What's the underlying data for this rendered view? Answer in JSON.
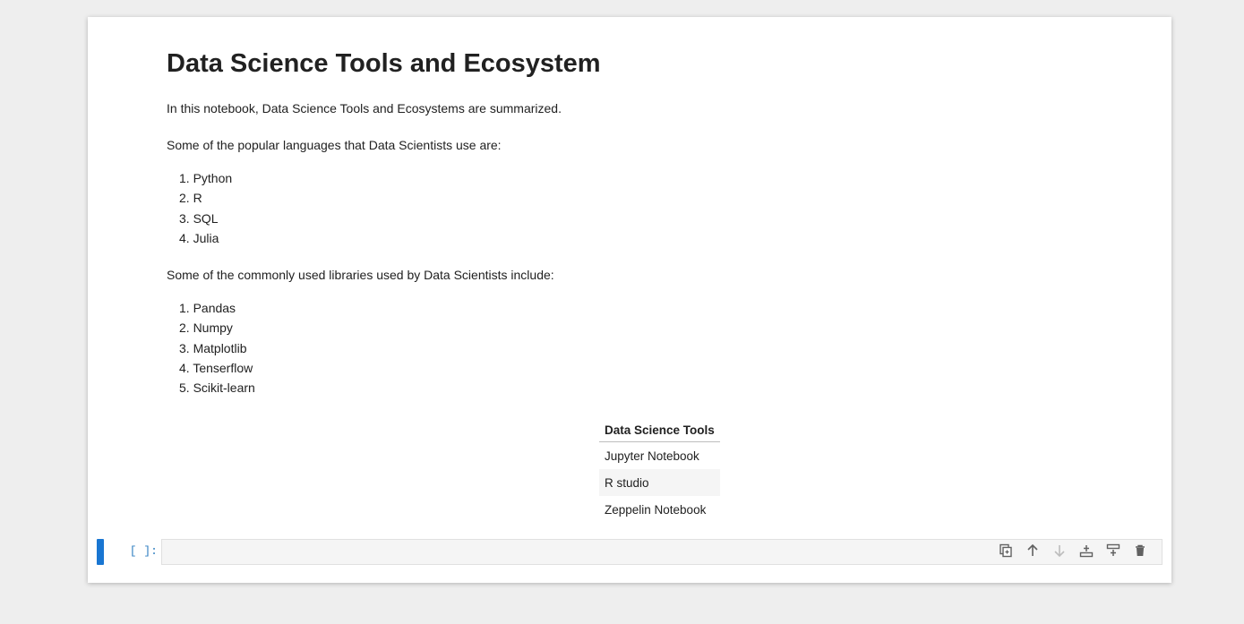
{
  "markdown": {
    "title": "Data Science Tools and Ecosystem",
    "intro": "In this notebook, Data Science Tools and Ecosystems are summarized.",
    "languages_heading": "Some of the popular languages that Data Scientists use are:",
    "languages": [
      "1. Python",
      "2. R",
      "3. SQL",
      "4. Julia"
    ],
    "libraries_heading": "Some of the commonly used libraries used by Data Scientists include:",
    "libraries": [
      "1. Pandas",
      "2. Numpy",
      "3. Matplotlib",
      "4. Tenserflow",
      "5. Scikit-learn"
    ],
    "table": {
      "header": "Data Science Tools",
      "rows": [
        "Jupyter Notebook",
        "R studio",
        "Zeppelin Notebook"
      ]
    }
  },
  "code_cell": {
    "prompt": "[ ]:",
    "input_value": "",
    "toolbar": [
      "duplicate-icon",
      "move-up-icon",
      "move-down-icon",
      "insert-above-icon",
      "insert-below-icon",
      "delete-icon"
    ]
  },
  "colors": {
    "active_bar": "#1976d2",
    "prompt": "#307fc1",
    "background": "#eeeeee"
  }
}
